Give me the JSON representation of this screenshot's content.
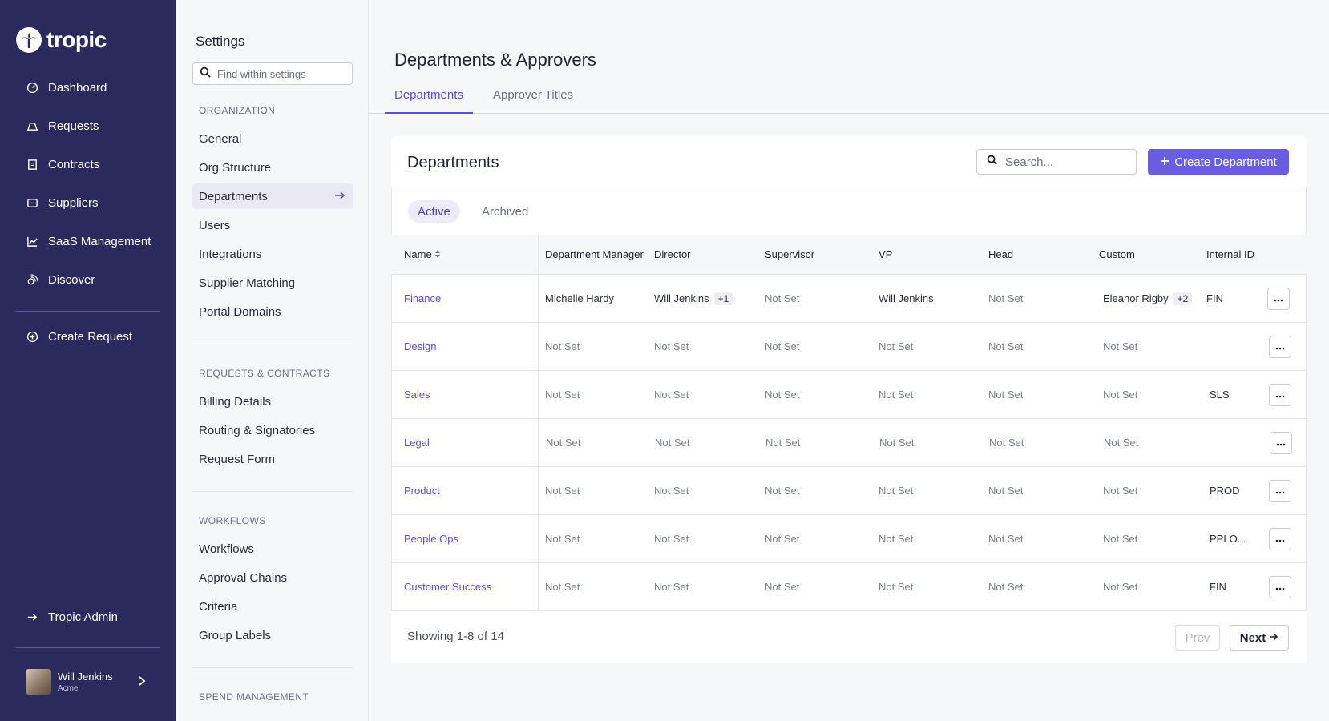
{
  "brand": {
    "name": "tropic"
  },
  "leftnav": {
    "items": [
      {
        "label": "Dashboard",
        "icon": "dashboard-icon"
      },
      {
        "label": "Requests",
        "icon": "requests-icon"
      },
      {
        "label": "Contracts",
        "icon": "contracts-icon"
      },
      {
        "label": "Suppliers",
        "icon": "suppliers-icon"
      },
      {
        "label": "SaaS Management",
        "icon": "chart-icon"
      },
      {
        "label": "Discover",
        "icon": "discover-icon"
      }
    ],
    "create_request": "Create Request",
    "admin": "Tropic Admin",
    "user": {
      "name": "Will Jenkins",
      "org": "Acme"
    }
  },
  "settings": {
    "title": "Settings",
    "search_placeholder": "Find within settings",
    "sections": [
      {
        "label": "ORGANIZATION",
        "items": [
          "General",
          "Org Structure",
          "Departments",
          "Users",
          "Integrations",
          "Supplier Matching",
          "Portal Domains"
        ]
      },
      {
        "label": "REQUESTS & CONTRACTS",
        "items": [
          "Billing Details",
          "Routing & Signatories",
          "Request Form"
        ]
      },
      {
        "label": "WORKFLOWS",
        "items": [
          "Workflows",
          "Approval Chains",
          "Criteria",
          "Group Labels"
        ]
      },
      {
        "label": "SPEND MANAGEMENT",
        "items": []
      }
    ],
    "active_item": "Departments"
  },
  "main": {
    "title": "Departments & Approvers",
    "tabs": [
      {
        "label": "Departments",
        "active": true
      },
      {
        "label": "Approver Titles",
        "active": false
      }
    ],
    "card": {
      "title": "Departments",
      "search_placeholder": "Search...",
      "create_button": "Create Department",
      "filters": [
        {
          "label": "Active",
          "active": true
        },
        {
          "label": "Archived",
          "active": false
        }
      ],
      "columns": [
        "Name",
        "Department Manager",
        "Director",
        "Supervisor",
        "VP",
        "Head",
        "Custom",
        "Internal ID"
      ],
      "rows": [
        {
          "name": "Finance",
          "manager": "Michelle Hardy",
          "director": "Will Jenkins",
          "director_extra": "+1",
          "supervisor": "Not Set",
          "vp": "Will Jenkins",
          "head": "Not Set",
          "custom": "Eleanor Rigby",
          "custom_extra": "+2",
          "internal_id": "FIN"
        },
        {
          "name": "Design",
          "manager": "Not Set",
          "director": "Not Set",
          "supervisor": "Not Set",
          "vp": "Not Set",
          "head": "Not Set",
          "custom": "Not Set",
          "internal_id": ""
        },
        {
          "name": "Sales",
          "manager": "Not Set",
          "director": "Not Set",
          "supervisor": "Not Set",
          "vp": "Not Set",
          "head": "Not Set",
          "custom": "Not Set",
          "internal_id": "SLS"
        },
        {
          "name": "Legal",
          "manager": "Not Set",
          "director": "Not Set",
          "supervisor": "Not Set",
          "vp": "Not Set",
          "head": "Not Set",
          "custom": "Not Set",
          "internal_id": ""
        },
        {
          "name": "Product",
          "manager": "Not Set",
          "director": "Not Set",
          "supervisor": "Not Set",
          "vp": "Not Set",
          "head": "Not Set",
          "custom": "Not Set",
          "internal_id": "PROD"
        },
        {
          "name": "People Ops",
          "manager": "Not Set",
          "director": "Not Set",
          "supervisor": "Not Set",
          "vp": "Not Set",
          "head": "Not Set",
          "custom": "Not Set",
          "internal_id": "PPLO..."
        },
        {
          "name": "Customer Success",
          "manager": "Not Set",
          "director": "Not Set",
          "supervisor": "Not Set",
          "vp": "Not Set",
          "head": "Not Set",
          "custom": "Not Set",
          "internal_id": "FIN"
        }
      ],
      "footer": {
        "showing": "Showing 1-8 of 14",
        "prev": "Prev",
        "next": "Next"
      }
    }
  },
  "colors": {
    "nav_bg": "#2b2a5c",
    "accent": "#6a5ee0",
    "link": "#5b4fd6"
  }
}
